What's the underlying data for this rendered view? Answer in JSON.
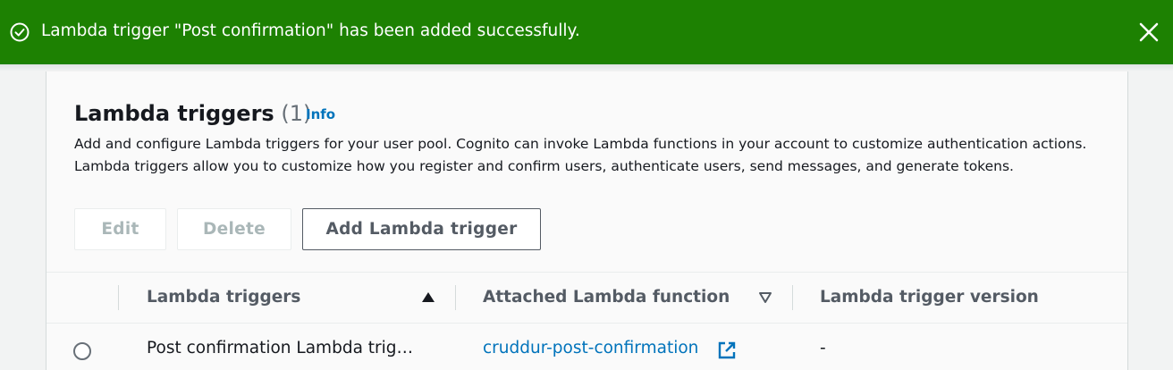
{
  "flash": {
    "message": "Lambda trigger \"Post confirmation\" has been added successfully.",
    "status_icon": "success-check-circle-icon",
    "close_icon": "close-icon",
    "color": "#1d8102"
  },
  "panel": {
    "title": "Lambda triggers",
    "count": "(1)",
    "info_label": "Info",
    "description": "Add and configure Lambda triggers for your user pool. Cognito can invoke Lambda functions in your account to customize authentication actions. Lambda triggers allow you to customize how you register and confirm users, authenticate users, send messages, and generate tokens."
  },
  "actions": {
    "edit_label": "Edit",
    "delete_label": "Delete",
    "add_label": "Add Lambda trigger"
  },
  "table": {
    "columns": [
      {
        "label": "Lambda triggers",
        "sort": "ascending"
      },
      {
        "label": "Attached Lambda function",
        "sort": "unsorted"
      },
      {
        "label": "Lambda trigger version"
      }
    ],
    "rows": [
      {
        "trigger": "Post confirmation Lambda trig…",
        "function": "cruddur-post-confirmation",
        "version": "-"
      }
    ]
  },
  "colors": {
    "link": "#0073bb",
    "success": "#1d8102"
  }
}
